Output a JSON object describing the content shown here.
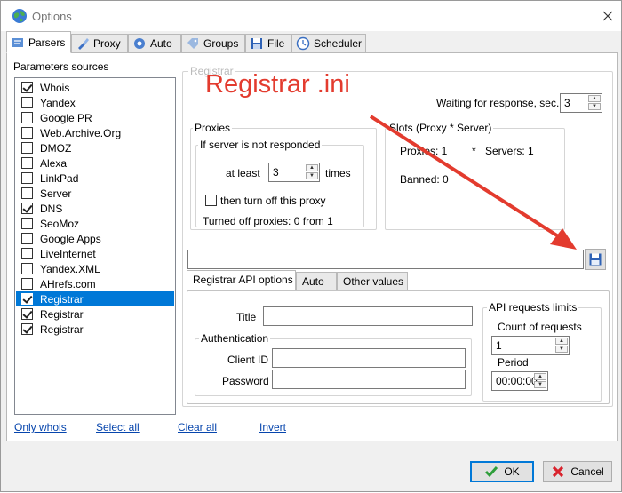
{
  "window": {
    "title": "Options"
  },
  "tabs": [
    {
      "label": "Parsers",
      "active": true
    },
    {
      "label": "Proxy"
    },
    {
      "label": "Auto"
    },
    {
      "label": "Groups"
    },
    {
      "label": "File"
    },
    {
      "label": "Scheduler"
    }
  ],
  "sources": {
    "title": "Parameters sources",
    "items": [
      {
        "label": "Whois",
        "checked": true
      },
      {
        "label": "Yandex",
        "checked": false
      },
      {
        "label": "Google PR",
        "checked": false
      },
      {
        "label": "Web.Archive.Org",
        "checked": false
      },
      {
        "label": "DMOZ",
        "checked": false
      },
      {
        "label": "Alexa",
        "checked": false
      },
      {
        "label": "LinkPad",
        "checked": false
      },
      {
        "label": "Server",
        "checked": false
      },
      {
        "label": "DNS",
        "checked": true
      },
      {
        "label": "SeoMoz",
        "checked": false
      },
      {
        "label": "Google Apps",
        "checked": false
      },
      {
        "label": "LiveInternet",
        "checked": false
      },
      {
        "label": "Yandex.XML",
        "checked": false
      },
      {
        "label": "AHrefs.com",
        "checked": false
      },
      {
        "label": "Registrar",
        "checked": true,
        "selected": true
      },
      {
        "label": "Registrar",
        "checked": true
      },
      {
        "label": "Registrar",
        "checked": true
      }
    ]
  },
  "links": {
    "only_whois": "Only whois",
    "select_all": "Select all",
    "clear_all": "Clear all",
    "invert": "Invert"
  },
  "registrar": {
    "group_title": "Registrar",
    "waiting_label": "Waiting for response, sec.",
    "waiting_value": "3",
    "proxies": {
      "title": "Proxies",
      "if_not_responded": "If server is not responded",
      "at_least": "at least",
      "at_least_value": "3",
      "times": "times",
      "turn_off": "then turn off this proxy",
      "turned_off": "Turned off proxies: 0 from 1"
    },
    "slots": {
      "title": "Slots (Proxy * Server)",
      "proxies": "Proxies: 1",
      "star": "*",
      "servers": "Servers: 1",
      "banned": "Banned: 0"
    },
    "ini_path": "",
    "subtabs": [
      "Registrar API options",
      "Auto",
      "Other values"
    ],
    "title_label": "Title",
    "title_value": "",
    "auth": {
      "title": "Authentication",
      "client_id_label": "Client ID",
      "client_id_value": "",
      "password_label": "Password",
      "password_value": ""
    },
    "limits": {
      "title": "API requests limits",
      "count_label": "Count of requests",
      "count_value": "1",
      "period_label": "Period",
      "period_value": "00:00:00"
    }
  },
  "buttons": {
    "ok": "OK",
    "cancel": "Cancel"
  },
  "annotation": {
    "text": "Registrar .ini",
    "color": "#e33b2e"
  },
  "colors": {
    "selection": "#0078d7",
    "link": "#0645ad"
  }
}
